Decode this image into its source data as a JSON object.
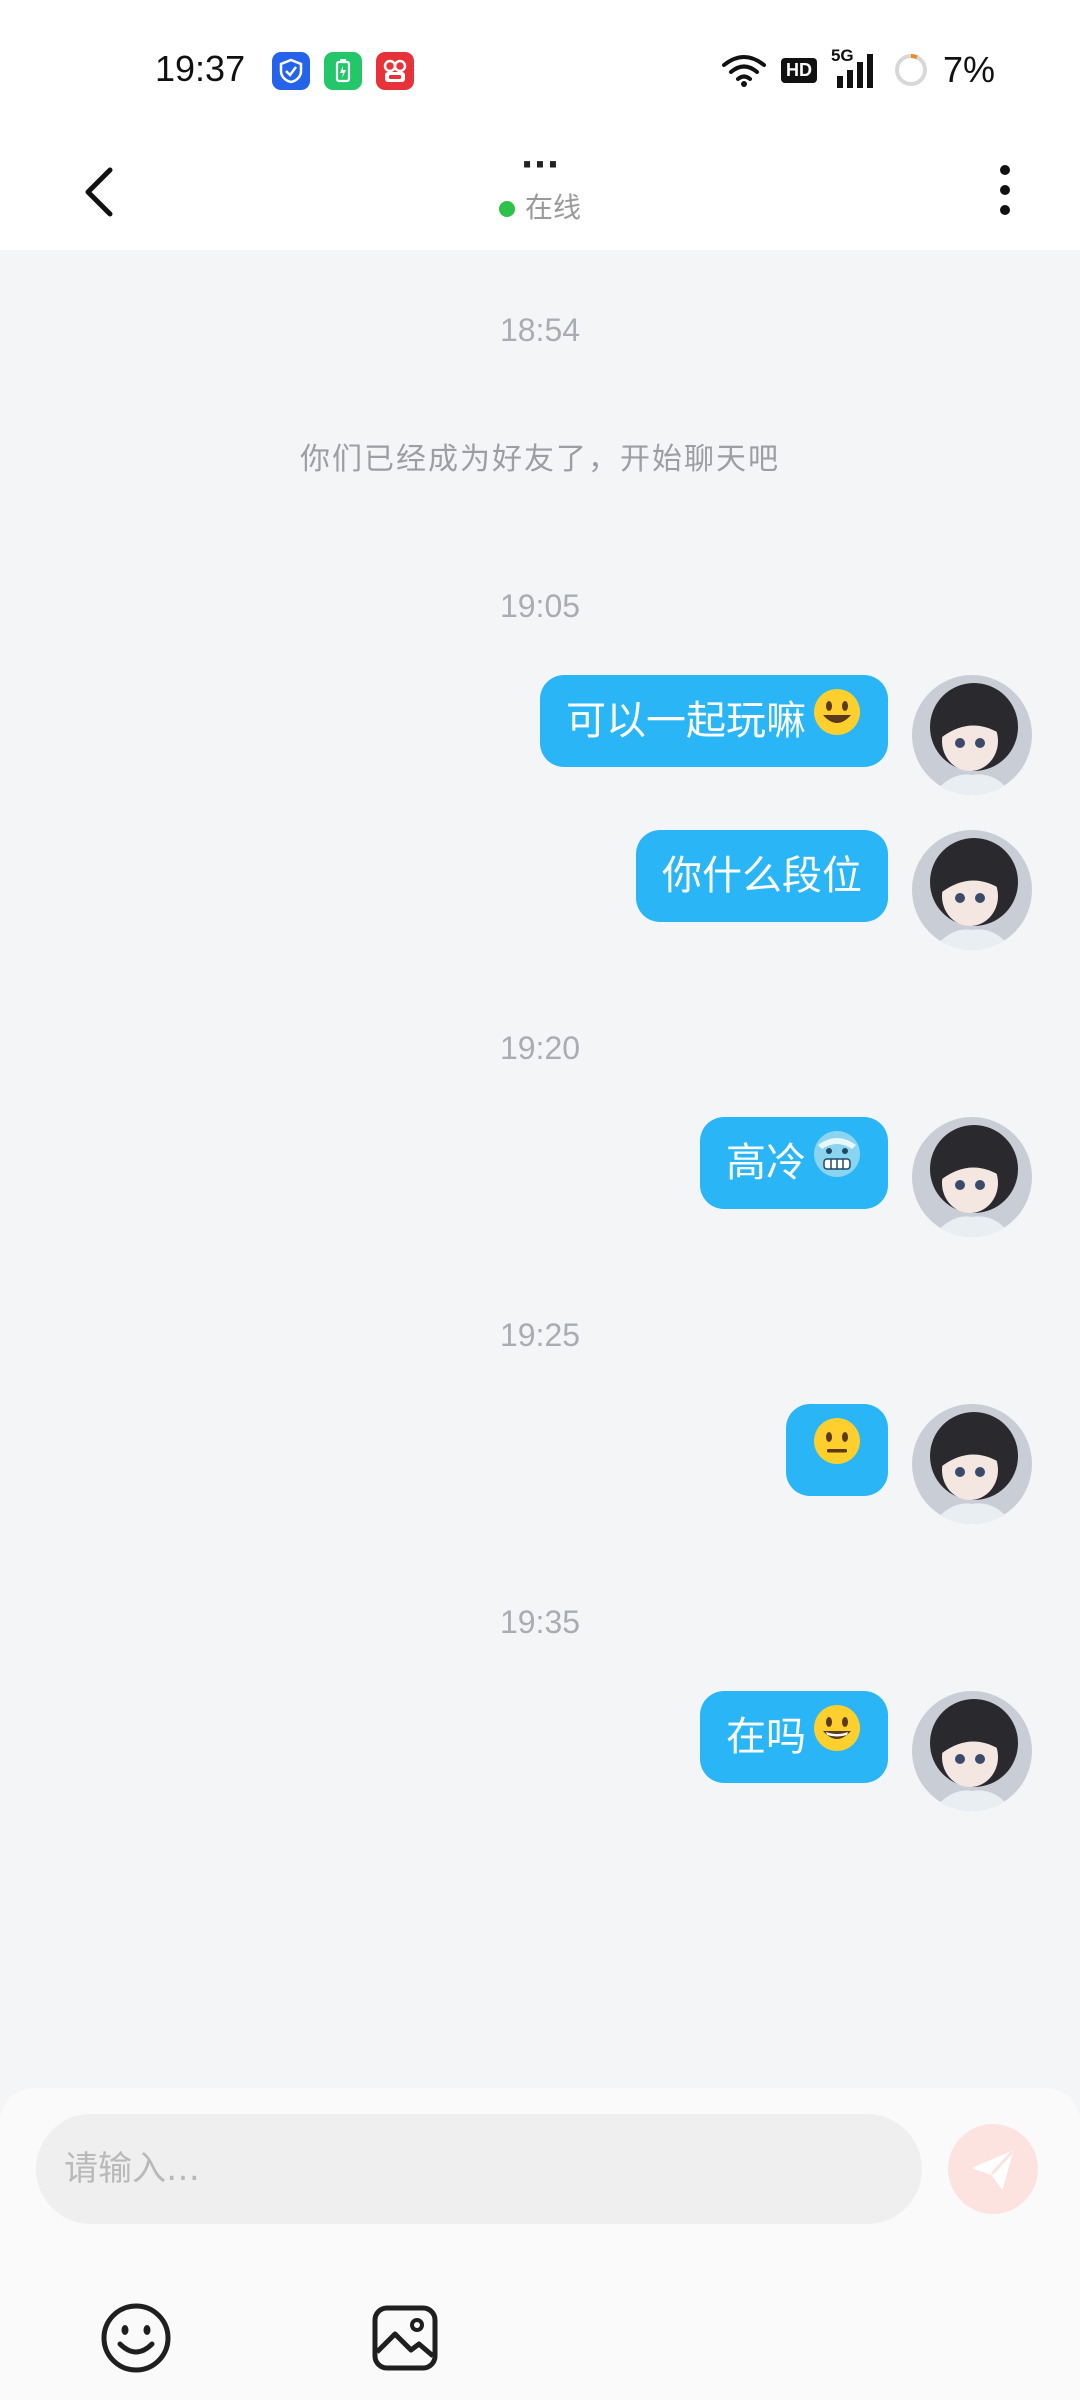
{
  "status_bar": {
    "time": "19:37",
    "network": "5G",
    "hd": "HD",
    "battery": "7%",
    "icons": [
      "shield-app-icon",
      "battery-saver-app-icon",
      "video-app-icon",
      "wifi-icon",
      "signal-icon",
      "battery-ring-icon"
    ]
  },
  "header": {
    "title": "···",
    "status": "在线",
    "status_color": "#2ec24a"
  },
  "chat": {
    "timestamps": [
      "18:54",
      "19:05",
      "19:20",
      "19:25",
      "19:35"
    ],
    "system_message": "你们已经成为好友了，开始聊天吧",
    "messages": [
      {
        "text": "可以一起玩嘛",
        "emoji": "smiley-face-emoji"
      },
      {
        "text": "你什么段位",
        "emoji": ""
      },
      {
        "text": "高冷",
        "emoji": "cold-face-emoji"
      },
      {
        "text": "",
        "emoji": "neutral-face-emoji"
      },
      {
        "text": "在吗",
        "emoji": "grinning-face-emoji"
      }
    ],
    "bubble_color": "#2ab6f6"
  },
  "input": {
    "placeholder": "请输入…",
    "value": ""
  },
  "toolbar": {
    "icons": [
      "emoji-icon",
      "image-icon"
    ]
  }
}
